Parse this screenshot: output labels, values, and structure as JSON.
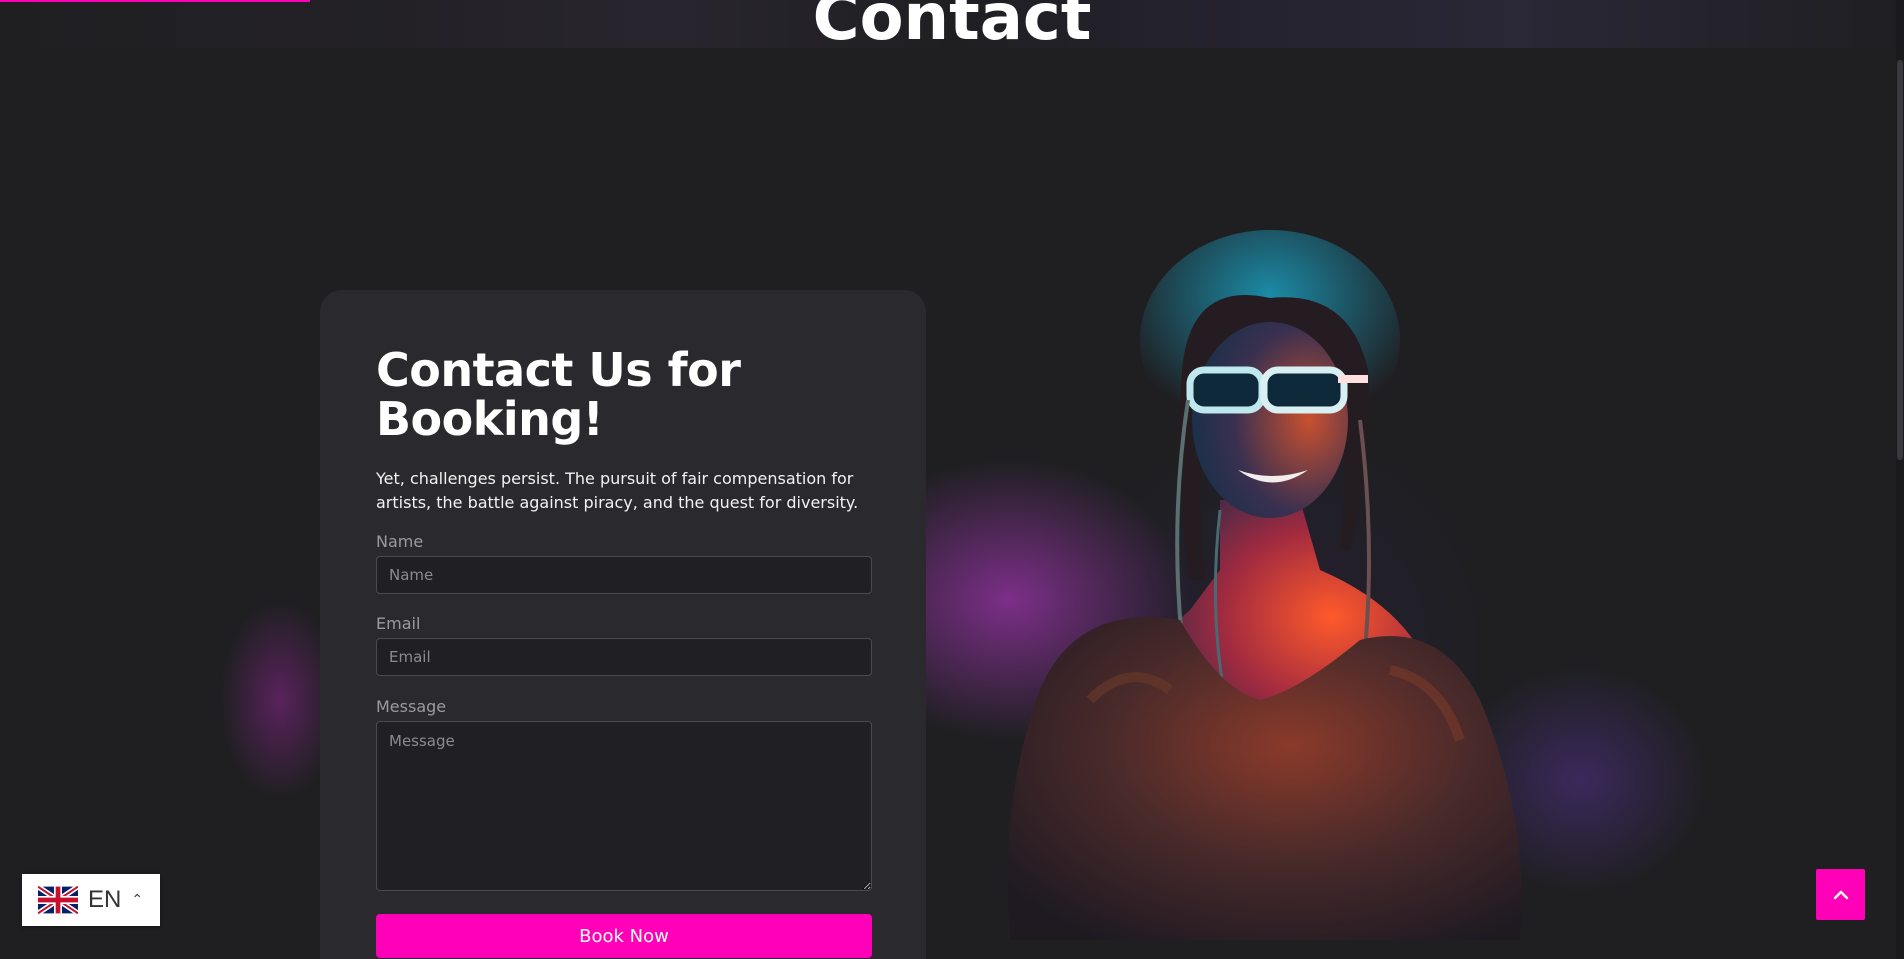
{
  "hero": {
    "title": "Contact"
  },
  "card": {
    "title": "Contact Us for Booking!",
    "description": "Yet, challenges persist. The pursuit of fair compensation for artists, the battle against piracy, and the quest for diversity.",
    "fields": {
      "name": {
        "label": "Name",
        "placeholder": "Name"
      },
      "email": {
        "label": "Email",
        "placeholder": "Email"
      },
      "message": {
        "label": "Message",
        "placeholder": "Message"
      }
    },
    "button_label": "Book Now"
  },
  "language": {
    "code": "EN",
    "flag_icon": "uk-flag-icon",
    "chevron_icon": "chevron-up-icon"
  },
  "scroll_top": {
    "icon": "chevron-up-icon"
  },
  "colors": {
    "accent": "#ff00b8",
    "background": "#1f1f22",
    "card": "#2a2a2e"
  }
}
